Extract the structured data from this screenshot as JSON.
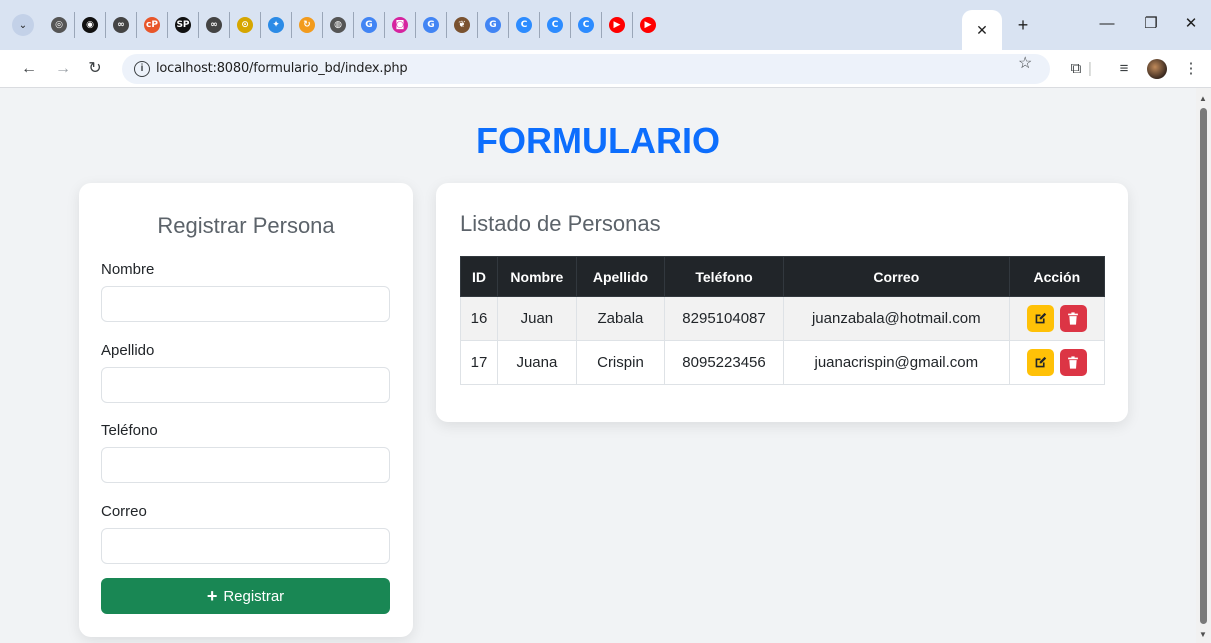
{
  "browser": {
    "url": "localhost:8080/formulario_bd/index.php",
    "tabs": [
      {
        "icon": "openai-icon",
        "color": "#555555",
        "glyph": "◎"
      },
      {
        "icon": "chatgpt-icon",
        "color": "#111111",
        "glyph": "◉"
      },
      {
        "icon": "meta-icon",
        "color": "#444444",
        "glyph": "∞"
      },
      {
        "icon": "codepen-icon",
        "color": "#e8562a",
        "glyph": "cP"
      },
      {
        "icon": "sp-icon",
        "color": "#111111",
        "glyph": "SP"
      },
      {
        "icon": "meta-icon",
        "color": "#444444",
        "glyph": "∞"
      },
      {
        "icon": "timer-icon",
        "color": "#d6a600",
        "glyph": "⊙"
      },
      {
        "icon": "sparkle-icon",
        "color": "#2b8be6",
        "glyph": "✦"
      },
      {
        "icon": "loop-icon",
        "color": "#f29b1d",
        "glyph": "↻"
      },
      {
        "icon": "globe-icon",
        "color": "#555555",
        "glyph": "◍"
      },
      {
        "icon": "google-icon",
        "color": "#4285f4",
        "glyph": "G"
      },
      {
        "icon": "instagram-icon",
        "color": "#d6249f",
        "glyph": "◙"
      },
      {
        "icon": "google-icon",
        "color": "#4285f4",
        "glyph": "G"
      },
      {
        "icon": "birds-icon",
        "color": "#7a5230",
        "glyph": "❦"
      },
      {
        "icon": "google-icon",
        "color": "#4285f4",
        "glyph": "G"
      },
      {
        "icon": "copilot-icon",
        "color": "#2d8cff",
        "glyph": "C"
      },
      {
        "icon": "copilot-icon",
        "color": "#2d8cff",
        "glyph": "C"
      },
      {
        "icon": "copilot-icon",
        "color": "#2d8cff",
        "glyph": "C"
      },
      {
        "icon": "youtube-icon",
        "color": "#ff0000",
        "glyph": "▶"
      },
      {
        "icon": "youtube-icon",
        "color": "#ff0000",
        "glyph": "▶"
      }
    ]
  },
  "page": {
    "title": "FORMULARIO"
  },
  "form": {
    "title": "Registrar Persona",
    "fields": [
      {
        "label": "Nombre",
        "value": ""
      },
      {
        "label": "Apellido",
        "value": ""
      },
      {
        "label": "Teléfono",
        "value": ""
      },
      {
        "label": "Correo",
        "value": ""
      }
    ],
    "submit_label": "Registrar"
  },
  "list": {
    "title": "Listado de Personas",
    "columns": [
      "ID",
      "Nombre",
      "Apellido",
      "Teléfono",
      "Correo",
      "Acción"
    ],
    "rows": [
      {
        "id": "16",
        "nombre": "Juan",
        "apellido": "Zabala",
        "telefono": "8295104087",
        "correo": "juanzabala@hotmail.com"
      },
      {
        "id": "17",
        "nombre": "Juana",
        "apellido": "Crispin",
        "telefono": "8095223456",
        "correo": "juanacrispin@gmail.com"
      }
    ]
  },
  "colors": {
    "primary": "#0d6efd",
    "success": "#198754",
    "warning": "#ffc107",
    "danger": "#dc3545",
    "table_header": "#212529"
  }
}
